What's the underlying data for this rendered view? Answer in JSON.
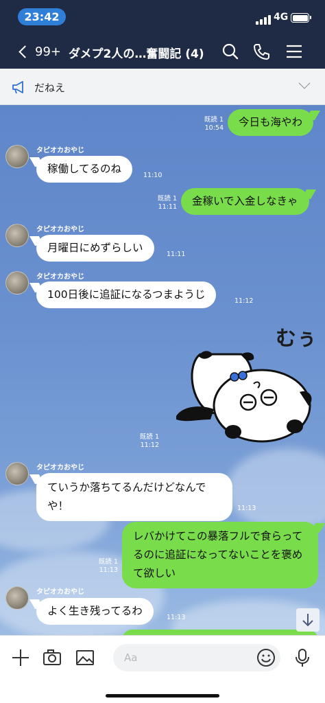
{
  "status_bar": {
    "time": "23:42",
    "network": "4G"
  },
  "header": {
    "back_count": "99+",
    "title": "ダメプ2人の…奮闘記 (4)"
  },
  "notice": {
    "text": "だねえ"
  },
  "messages": [
    {
      "dir": "out",
      "text": "今日も海やわ",
      "read": "既読 1",
      "time": "10:54"
    },
    {
      "dir": "in",
      "sender": "タピオカおやじ",
      "text": "稼働してるのね",
      "time": "11:10"
    },
    {
      "dir": "out",
      "text": "金稼いで入金しなきゃ",
      "read": "既読 1",
      "time": "11:11"
    },
    {
      "dir": "in",
      "sender": "タピオカおやじ",
      "text": "月曜日にめずらしい",
      "time": "11:11"
    },
    {
      "dir": "in",
      "sender": "タピオカおやじ",
      "text": "100日後に追証になるつまようじ",
      "time": "11:12"
    },
    {
      "dir": "out-sticker",
      "sticker_text": "むぅ",
      "read": "既読 1",
      "time": "11:12"
    },
    {
      "dir": "in",
      "sender": "タピオカおやじ",
      "text": "ていうか落ちてるんだけどなんでや！",
      "time": "11:13"
    },
    {
      "dir": "out",
      "text": "レバかけてこの暴落フルで食らってるのに追証になってないことを褒めて欲しい",
      "read": "既読 1",
      "time": "11:13"
    },
    {
      "dir": "in",
      "sender": "タピオカおやじ",
      "text": "よく生き残ってるわ",
      "time": "11:13"
    }
  ],
  "composer": {
    "placeholder": "Aa"
  },
  "colors": {
    "header_bg": "#1f2a44",
    "outgoing_bubble": "#79dc4a",
    "incoming_bubble": "#ffffff",
    "time_badge": "#2f7fd9"
  },
  "icons": [
    "back-chevron-icon",
    "search-icon",
    "phone-icon",
    "menu-icon",
    "megaphone-icon",
    "chevron-down-icon",
    "plus-icon",
    "camera-icon",
    "image-icon",
    "emoji-icon",
    "mic-icon",
    "scroll-down-icon"
  ]
}
